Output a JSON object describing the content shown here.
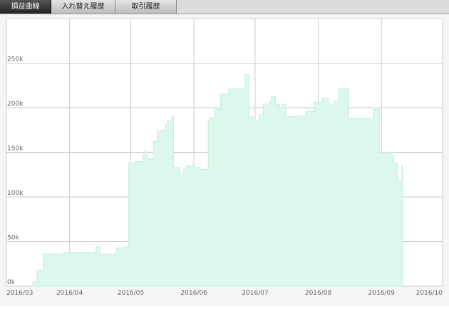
{
  "tabs": [
    {
      "label": "損益曲線",
      "active": true
    },
    {
      "label": "入れ替え履歴",
      "active": false
    },
    {
      "label": "取引履歴",
      "active": false
    }
  ],
  "chart_data": {
    "type": "area",
    "title": "",
    "xlabel": "",
    "ylabel": "",
    "grid": true,
    "fill_color": "#dcf8ec",
    "line_color": "#c6efdd",
    "y_ticks": [
      {
        "label": "0k",
        "value": 0
      },
      {
        "label": "50k",
        "value": 50000
      },
      {
        "label": "100k",
        "value": 100000
      },
      {
        "label": "150k",
        "value": 150000
      },
      {
        "label": "200k",
        "value": 200000
      },
      {
        "label": "250k",
        "value": 250000
      }
    ],
    "ylim": [
      0,
      300000
    ],
    "x_ticks": [
      {
        "label": "2016/03",
        "date": "2016-03-01"
      },
      {
        "label": "2016/04",
        "date": "2016-04-01"
      },
      {
        "label": "2016/05",
        "date": "2016-05-01"
      },
      {
        "label": "2016/06",
        "date": "2016-06-01"
      },
      {
        "label": "2016/07",
        "date": "2016-07-01"
      },
      {
        "label": "2016/08",
        "date": "2016-08-01"
      },
      {
        "label": "2016/09",
        "date": "2016-09-01"
      },
      {
        "label": "2016/10",
        "date": "2016-10-01"
      }
    ],
    "xlim": [
      "2016-03-01",
      "2016-10-01"
    ],
    "series": [
      {
        "x": [
          "2016-03-14",
          "2016-03-16",
          "2016-03-19",
          "2016-03-23",
          "2016-03-29",
          "2016-03-31",
          "2016-04-02",
          "2016-04-14",
          "2016-04-16",
          "2016-04-20",
          "2016-04-24",
          "2016-04-28",
          "2016-04-30",
          "2016-05-03",
          "2016-05-07",
          "2016-05-08",
          "2016-05-09",
          "2016-05-10",
          "2016-05-12",
          "2016-05-14",
          "2016-05-16",
          "2016-05-17",
          "2016-05-18",
          "2016-05-19",
          "2016-05-21",
          "2016-05-22",
          "2016-05-23",
          "2016-05-25",
          "2016-05-27",
          "2016-05-28",
          "2016-06-01",
          "2016-06-04",
          "2016-06-07",
          "2016-06-08",
          "2016-06-09",
          "2016-06-10",
          "2016-06-11",
          "2016-06-14",
          "2016-06-18",
          "2016-06-23",
          "2016-06-26",
          "2016-06-28",
          "2016-06-30",
          "2016-07-01",
          "2016-07-03",
          "2016-07-05",
          "2016-07-08",
          "2016-07-09",
          "2016-07-11",
          "2016-07-13",
          "2016-07-14",
          "2016-07-16",
          "2016-07-18",
          "2016-07-21",
          "2016-07-24",
          "2016-07-26",
          "2016-07-30",
          "2016-08-03",
          "2016-08-05",
          "2016-08-06",
          "2016-08-08",
          "2016-08-09",
          "2016-08-11",
          "2016-08-16",
          "2016-08-21",
          "2016-08-28",
          "2016-08-31",
          "2016-09-05",
          "2016-09-06",
          "2016-09-07",
          "2016-09-09",
          "2016-09-11"
        ],
        "y": [
          5000,
          18000,
          36000,
          36000,
          38000,
          38000,
          38000,
          44000,
          36000,
          36000,
          43000,
          44000,
          138000,
          140000,
          148000,
          151000,
          143000,
          142000,
          162000,
          173000,
          175000,
          175000,
          181000,
          186000,
          190000,
          133000,
          133000,
          126000,
          132000,
          135000,
          133000,
          131000,
          132000,
          186000,
          189000,
          188000,
          198000,
          215000,
          221000,
          222000,
          237000,
          190000,
          186000,
          186000,
          192000,
          204000,
          207000,
          213000,
          204000,
          200000,
          204000,
          190000,
          190000,
          191000,
          191000,
          196000,
          206000,
          211000,
          211000,
          203000,
          203000,
          208000,
          221000,
          188000,
          188000,
          198000,
          150000,
          150000,
          147000,
          138000,
          118000,
          135000
        ]
      }
    ]
  }
}
